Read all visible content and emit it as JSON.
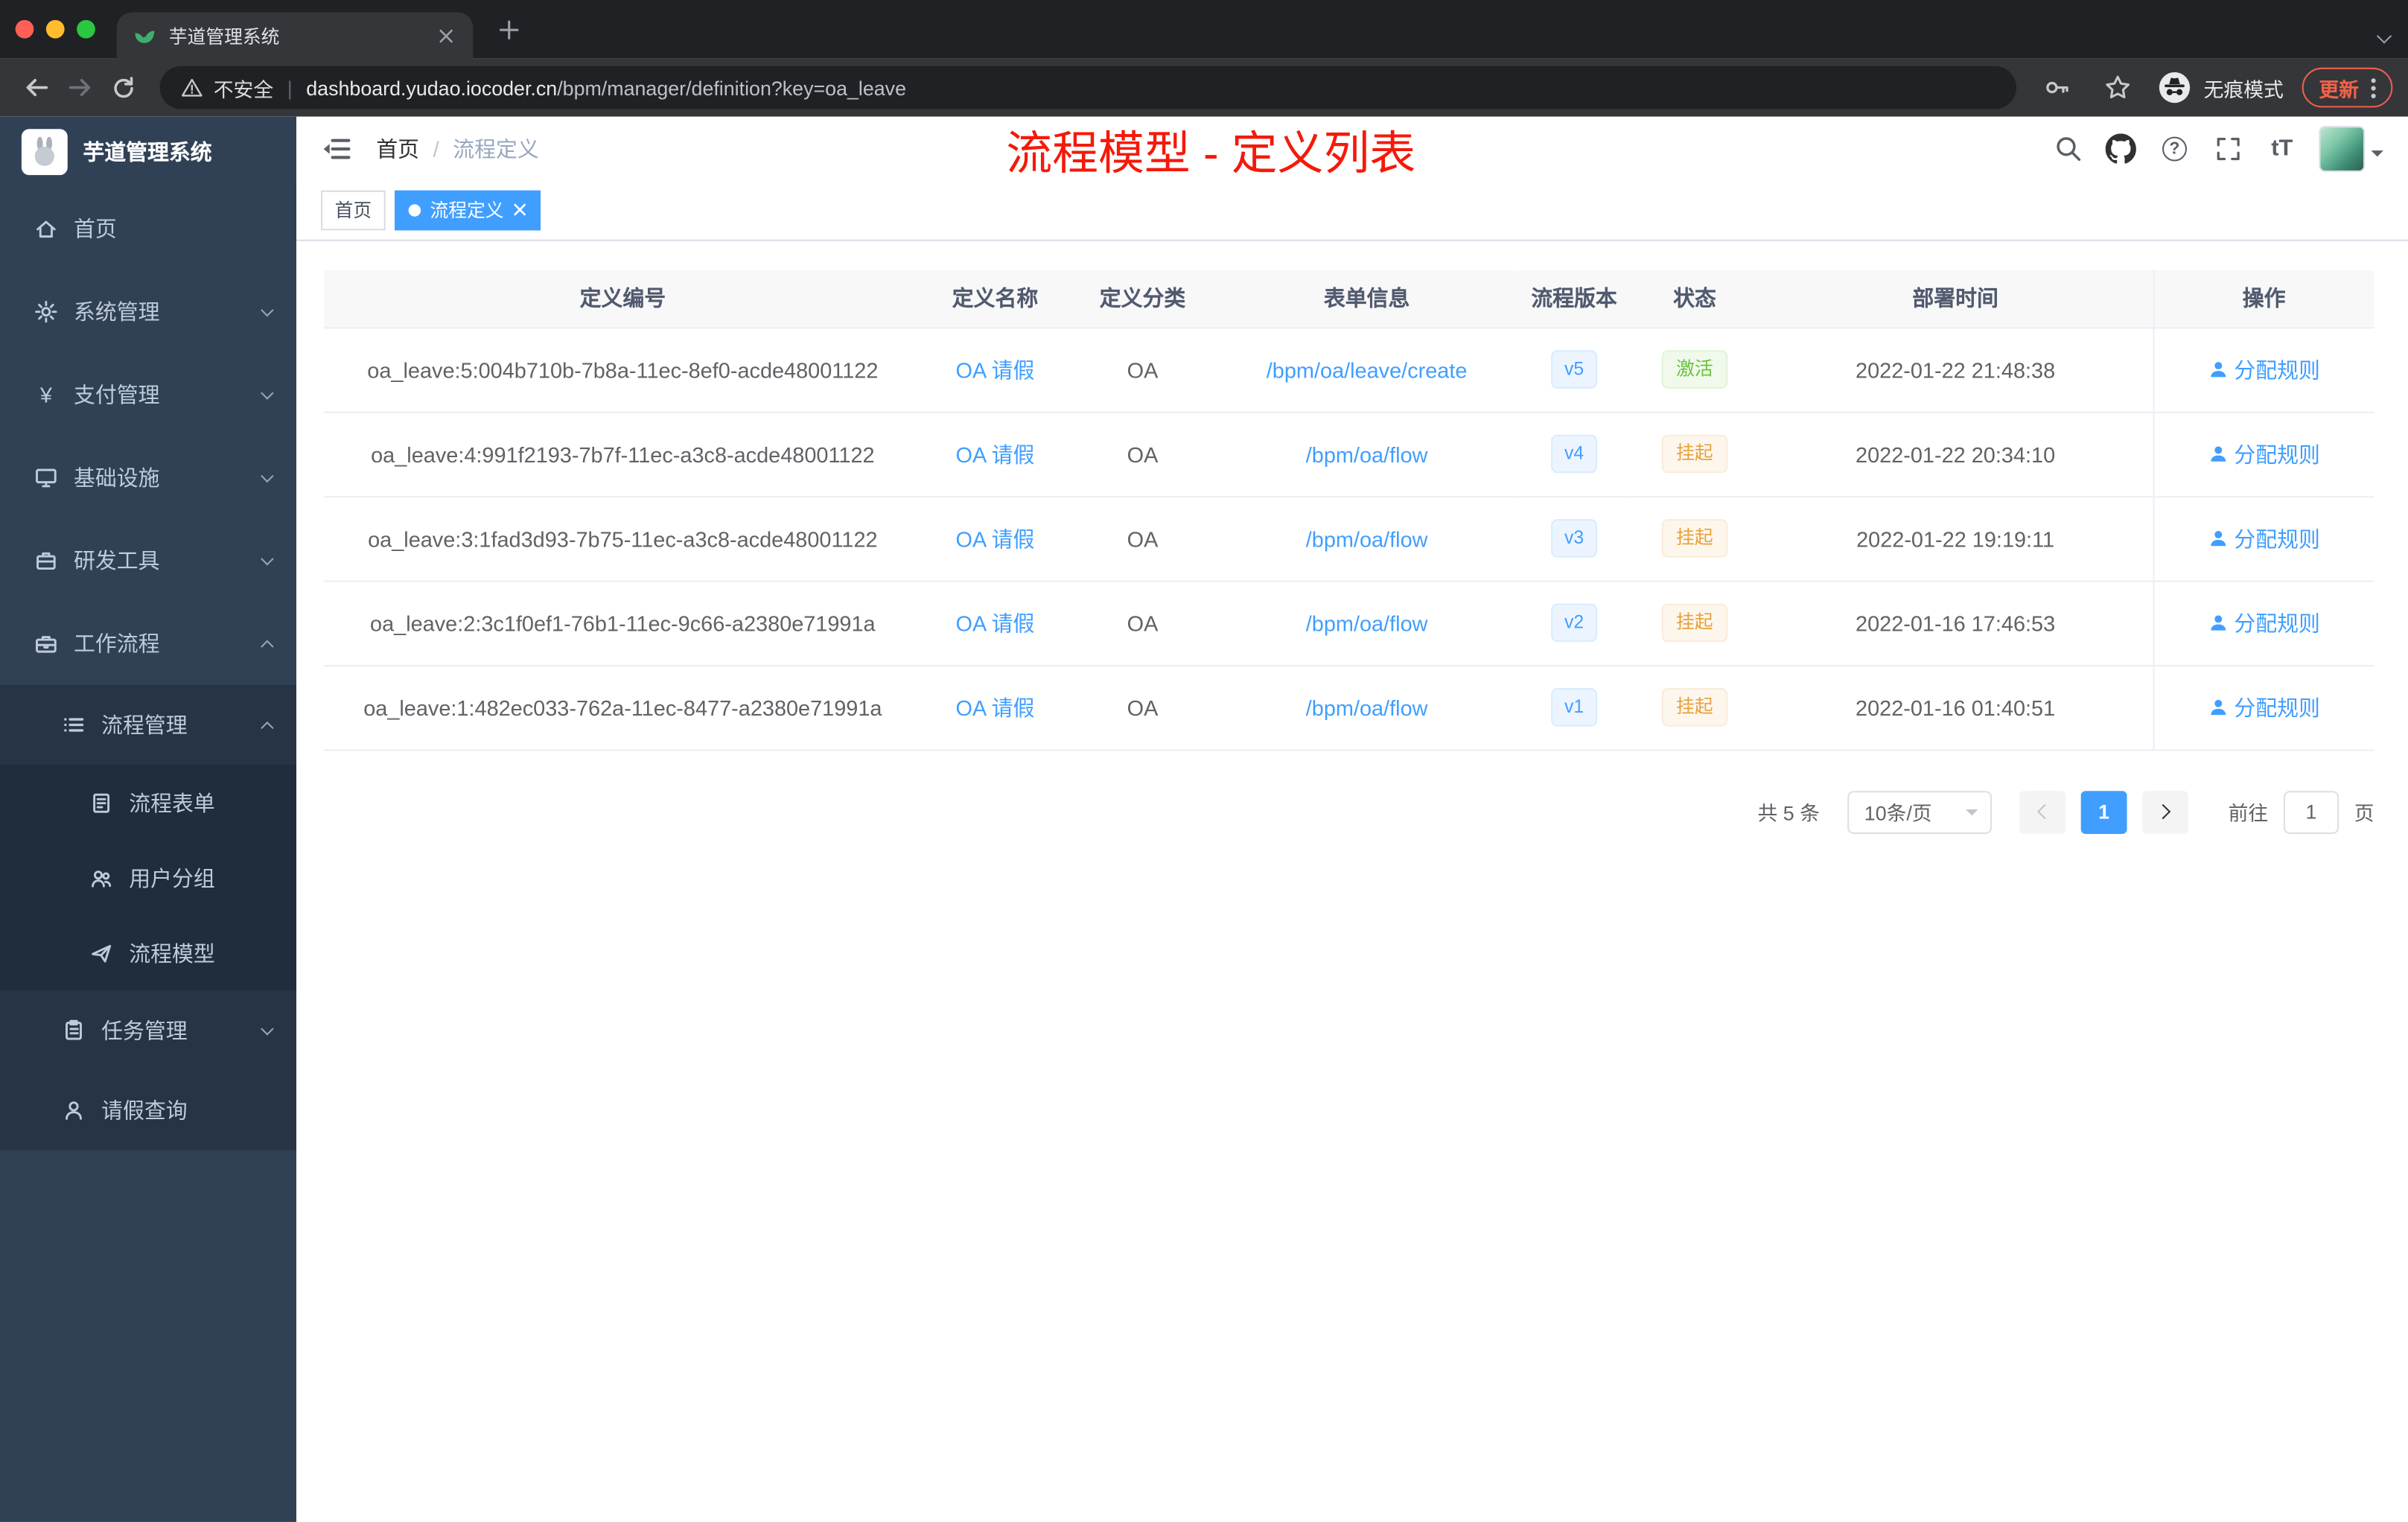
{
  "colors": {
    "accent": "#409EFF",
    "success": "#67c23a",
    "warning": "#e6a23c",
    "annotation_red": "#f5190a",
    "sidebar_bg": "#304156"
  },
  "browser": {
    "tab_title": "芋道管理系统",
    "security_label": "不安全",
    "url_host": "dashboard.yudao.iocoder.cn",
    "url_path": "/bpm/manager/definition?key=oa_leave",
    "incognito_label": "无痕模式",
    "update_label": "更新"
  },
  "sidebar": {
    "app_title": "芋道管理系统",
    "items": [
      {
        "label": "首页",
        "icon": "home-icon",
        "level": 1
      },
      {
        "label": "系统管理",
        "icon": "gear-icon",
        "level": 1,
        "expandable": true
      },
      {
        "label": "支付管理",
        "icon": "yen-icon",
        "glyph": "¥",
        "level": 1,
        "expandable": true
      },
      {
        "label": "基础设施",
        "icon": "monitor-icon",
        "level": 1,
        "expandable": true
      },
      {
        "label": "研发工具",
        "icon": "toolbox-icon",
        "level": 1,
        "expandable": true
      },
      {
        "label": "工作流程",
        "icon": "briefcase-icon",
        "level": 1,
        "expandable": true,
        "expanded": true
      },
      {
        "label": "流程管理",
        "icon": "list-icon",
        "level": 2,
        "expandable": true,
        "expanded": true
      },
      {
        "label": "流程表单",
        "icon": "form-icon",
        "level": 3
      },
      {
        "label": "用户分组",
        "icon": "users-icon",
        "level": 3
      },
      {
        "label": "流程模型",
        "icon": "send-icon",
        "level": 3
      },
      {
        "label": "任务管理",
        "icon": "task-icon",
        "level": 2,
        "expandable": true
      },
      {
        "label": "请假查询",
        "icon": "user-icon",
        "level": 2
      }
    ]
  },
  "header": {
    "breadcrumb_home": "首页",
    "breadcrumb_separator": "/",
    "breadcrumb_current": "流程定义",
    "annotation_title": "流程模型 - 定义列表",
    "icons": {
      "help_glyph": "?",
      "font_size_label": "tT",
      "right_icons": [
        "search-icon",
        "github-icon",
        "help-icon",
        "fullscreen-icon",
        "font-size-icon",
        "avatar"
      ]
    }
  },
  "tags": [
    {
      "label": "首页",
      "active": false
    },
    {
      "label": "流程定义",
      "active": true
    }
  ],
  "table": {
    "columns": [
      "定义编号",
      "定义名称",
      "定义分类",
      "表单信息",
      "流程版本",
      "状态",
      "部署时间",
      "操作"
    ],
    "rows": [
      {
        "id": "oa_leave:5:004b710b-7b8a-11ec-8ef0-acde48001122",
        "name": "OA 请假",
        "category": "OA",
        "form": "/bpm/oa/leave/create",
        "version": "v5",
        "status": "激活",
        "deploy_time": "2022-01-22 21:48:38",
        "action": "分配规则"
      },
      {
        "id": "oa_leave:4:991f2193-7b7f-11ec-a3c8-acde48001122",
        "name": "OA 请假",
        "category": "OA",
        "form": "/bpm/oa/flow",
        "version": "v4",
        "status": "挂起",
        "deploy_time": "2022-01-22 20:34:10",
        "action": "分配规则"
      },
      {
        "id": "oa_leave:3:1fad3d93-7b75-11ec-a3c8-acde48001122",
        "name": "OA 请假",
        "category": "OA",
        "form": "/bpm/oa/flow",
        "version": "v3",
        "status": "挂起",
        "deploy_time": "2022-01-22 19:19:11",
        "action": "分配规则"
      },
      {
        "id": "oa_leave:2:3c1f0ef1-76b1-11ec-9c66-a2380e71991a",
        "name": "OA 请假",
        "category": "OA",
        "form": "/bpm/oa/flow",
        "version": "v2",
        "status": "挂起",
        "deploy_time": "2022-01-16 17:46:53",
        "action": "分配规则"
      },
      {
        "id": "oa_leave:1:482ec033-762a-11ec-8477-a2380e71991a",
        "name": "OA 请假",
        "category": "OA",
        "form": "/bpm/oa/flow",
        "version": "v1",
        "status": "挂起",
        "deploy_time": "2022-01-16 01:40:51",
        "action": "分配规则"
      }
    ]
  },
  "pagination": {
    "total": "共 5 条",
    "page_size": "10条/页",
    "current_page": "1",
    "goto_label": "前往",
    "goto_value": "1",
    "page_unit": "页"
  }
}
